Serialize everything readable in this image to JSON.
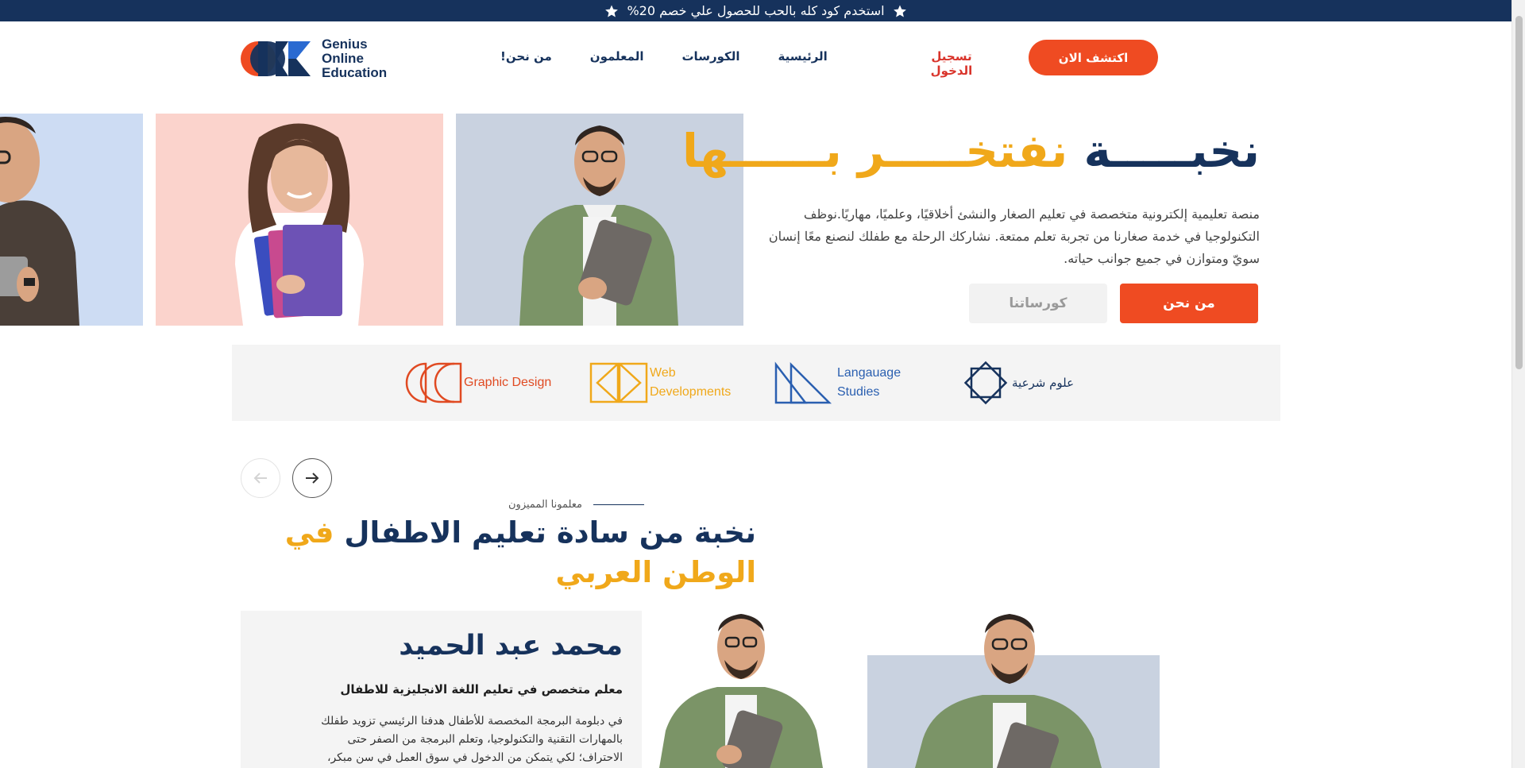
{
  "promo": {
    "text": "استخدم كود كله بالحب للحصول علي خصم 20%"
  },
  "brand": {
    "line1": "Genius",
    "line2": "Online",
    "line3": "Education"
  },
  "nav": {
    "home": "الرئيسية",
    "courses": "الكورسات",
    "teachers": "المعلمون",
    "about": "من نحن!"
  },
  "header": {
    "login": "تسجيل الدخول",
    "discover": "اكتشف الان"
  },
  "hero": {
    "title_blue": "نخبـــــة",
    "title_gold": "نفتخـــــر بــــــها",
    "description": "منصة تعليمية إلكترونية متخصصة في تعليم الصغار والنشئ أخلاقيًا، وعلميًا، مهاريًا.نوظف التكنولوجيا في خدمة صغارنا من تجربة تعلم ممتعة. نشاركك الرحلة مع طفلك لنصنع معًا إنسان سويّ ومتوازن في جميع جوانب حياته.",
    "about_btn": "من نحن",
    "courses_btn": "كورساتنا"
  },
  "categories": [
    {
      "label": "علوم شرعية",
      "icon": "diamond-square-icon",
      "color": "#16325c"
    },
    {
      "label": "Langauage Studies",
      "icon": "triangles-icon",
      "color": "#2a5fb0"
    },
    {
      "label": "Web Developments",
      "icon": "brackets-icon",
      "color": "#f0a81a"
    },
    {
      "label": "Graphic Design",
      "icon": "half-circles-icon",
      "color": "#e04a22"
    }
  ],
  "teachers_section": {
    "eyebrow": "معلمونا المميزون",
    "title_blue": "نخبة من سادة تعليم الاطفال",
    "title_gold": "في الوطن العربي"
  },
  "teacher": {
    "name": "محمد عبد الحميد",
    "role": "معلم متخصص في تعليم اللغة الانجليزية للاطفال",
    "bio": "في دبلومة البرمجة المخصصة للأطفال هدفنا الرئيسي تزويد طفلك بالمهارات التقنية والتكنولوجيا، وتعلم البرمجة من الصفر حتى الاحتراف؛ لكي يتمكن من الدخول في سوق العمل في سن مبكر، ويكون قادرًا على"
  },
  "colors": {
    "navy": "#16325c",
    "orange": "#ef4b22",
    "gold": "#f0a81a",
    "login_red": "#d9342b",
    "card_blue": "#c9d2e0",
    "card_pink": "#fbd3cc",
    "card_lightblue": "#cddcf3"
  }
}
